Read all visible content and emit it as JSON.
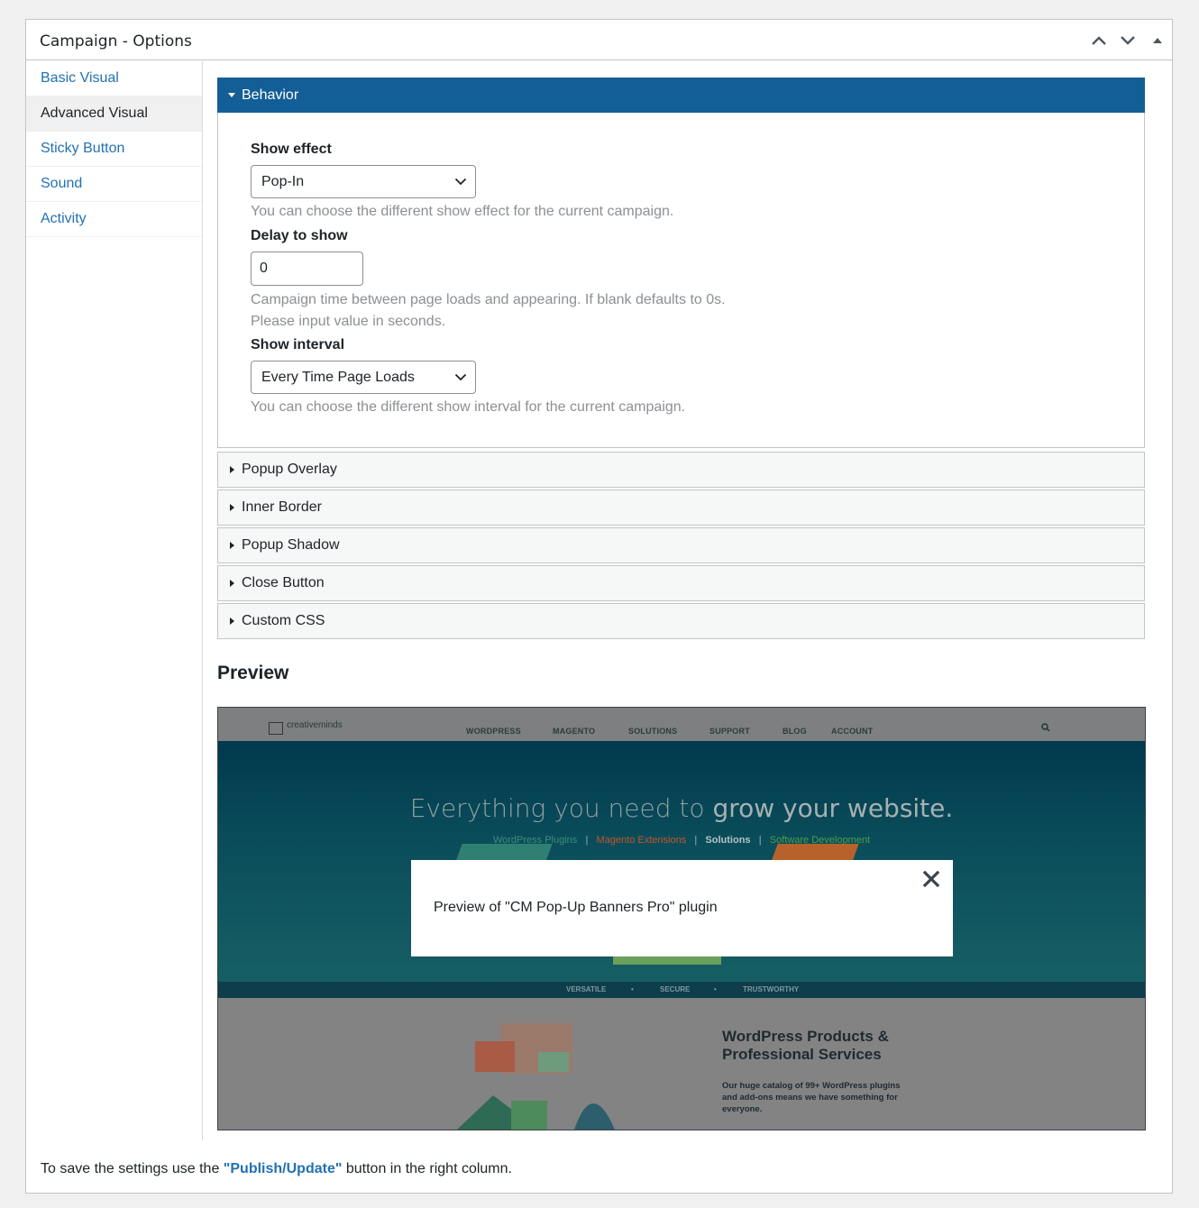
{
  "header": {
    "title": "Campaign - Options"
  },
  "sidebar": {
    "items": [
      {
        "label": "Basic Visual"
      },
      {
        "label": "Advanced Visual"
      },
      {
        "label": "Sticky Button"
      },
      {
        "label": "Sound"
      },
      {
        "label": "Activity"
      }
    ]
  },
  "sections": {
    "behavior": {
      "title": "Behavior",
      "show_effect": {
        "label": "Show effect",
        "value": "Pop-In",
        "help": "You can choose the different show effect for the current campaign."
      },
      "delay": {
        "label": "Delay to show",
        "value": "0",
        "help1": "Campaign time between page loads and appearing. If blank defaults to 0s.",
        "help2": "Please input value in seconds."
      },
      "show_interval": {
        "label": "Show interval",
        "value": "Every Time Page Loads",
        "help": "You can choose the different show interval for the current campaign."
      }
    },
    "collapsed": [
      {
        "title": "Popup Overlay"
      },
      {
        "title": "Inner Border"
      },
      {
        "title": "Popup Shadow"
      },
      {
        "title": "Close Button"
      },
      {
        "title": "Custom CSS"
      }
    ]
  },
  "preview": {
    "title": "Preview",
    "site": {
      "logo": "creativeminds",
      "nav": [
        "WORDPRESS",
        "MAGENTO",
        "SOLUTIONS",
        "SUPPORT",
        "BLOG",
        "ACCOUNT"
      ],
      "headline_light": "Everything you need to ",
      "headline_bold": "grow your website.",
      "sublinks": [
        "WordPress Plugins",
        "Magento Extensions",
        "Solutions",
        "Software Development"
      ],
      "band": [
        "VERSATILE",
        "SECURE",
        "TRUSTWORTHY"
      ],
      "lower_title_1": "WordPress Products &",
      "lower_title_2": "Professional Services",
      "lower_text_1": "Our huge catalog of 99+ WordPress plugins",
      "lower_text_2": "and add-ons means we have something for",
      "lower_text_3": "everyone."
    },
    "popup_text": "Preview of \"CM Pop-Up Banners Pro\" plugin"
  },
  "footer": {
    "before": "To save the settings use the ",
    "link": "\"Publish/Update\"",
    "after": " button in the right column."
  },
  "colors": {
    "accent": "#135e96",
    "link": "#2271b1",
    "sublink_wp": "#3b8f7a",
    "sublink_magento": "#c5552b",
    "sublink_solutions": "#b7c3c4",
    "sublink_software": "#4e9e47"
  }
}
